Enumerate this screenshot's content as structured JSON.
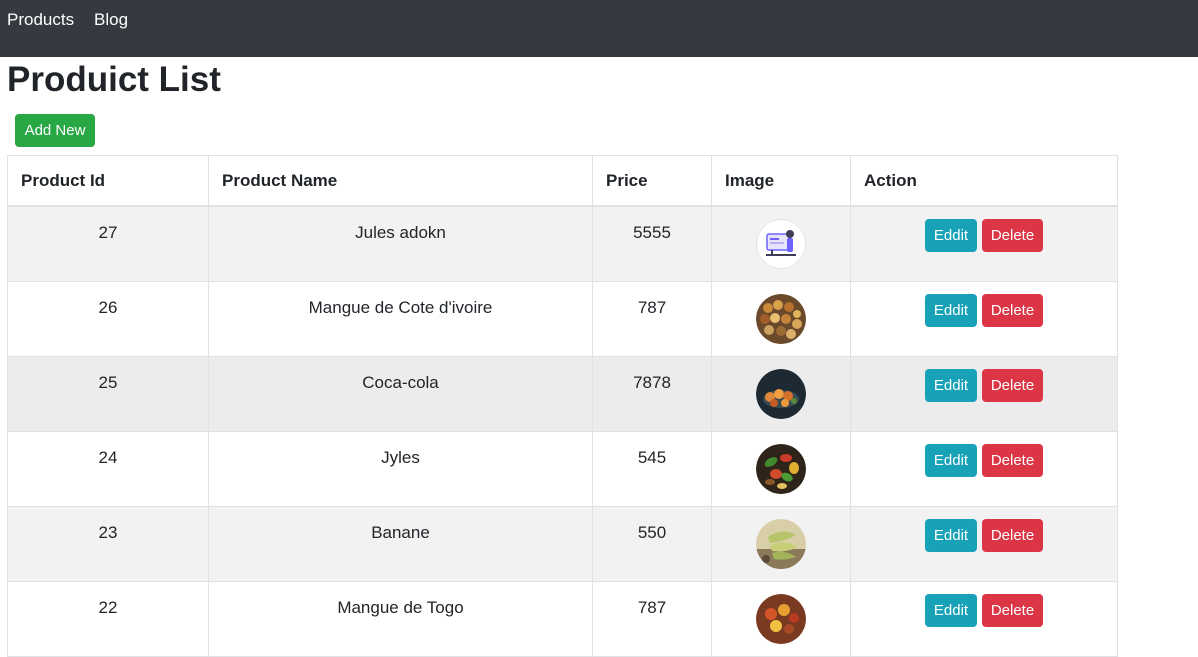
{
  "nav": {
    "items": [
      {
        "label": "Products"
      },
      {
        "label": "Blog"
      }
    ]
  },
  "page": {
    "title": "Produict List",
    "add_label": "Add New"
  },
  "table": {
    "headers": [
      "Product Id",
      "Product Name",
      "Price",
      "Image",
      "Action"
    ],
    "edit_label": "Eddit",
    "delete_label": "Delete",
    "rows": [
      {
        "id": "27",
        "name": "Jules adokn",
        "price": "5555",
        "image": "illustration-thumbnail"
      },
      {
        "id": "26",
        "name": "Mangue de Cote d'ivoire",
        "price": "787",
        "image": "market-produce-thumbnail"
      },
      {
        "id": "25",
        "name": "Coca-cola",
        "price": "7878",
        "image": "food-platter-thumbnail"
      },
      {
        "id": "24",
        "name": "Jyles",
        "price": "545",
        "image": "vegetables-thumbnail"
      },
      {
        "id": "23",
        "name": "Banane",
        "price": "550",
        "image": "banana-bunch-thumbnail"
      },
      {
        "id": "22",
        "name": "Mangue de Togo",
        "price": "787",
        "image": "spices-thumbnail"
      }
    ]
  },
  "colors": {
    "navbar": "#343a40",
    "add_button": "#28a745",
    "edit_button": "#17a2b8",
    "delete_button": "#dc3545"
  }
}
